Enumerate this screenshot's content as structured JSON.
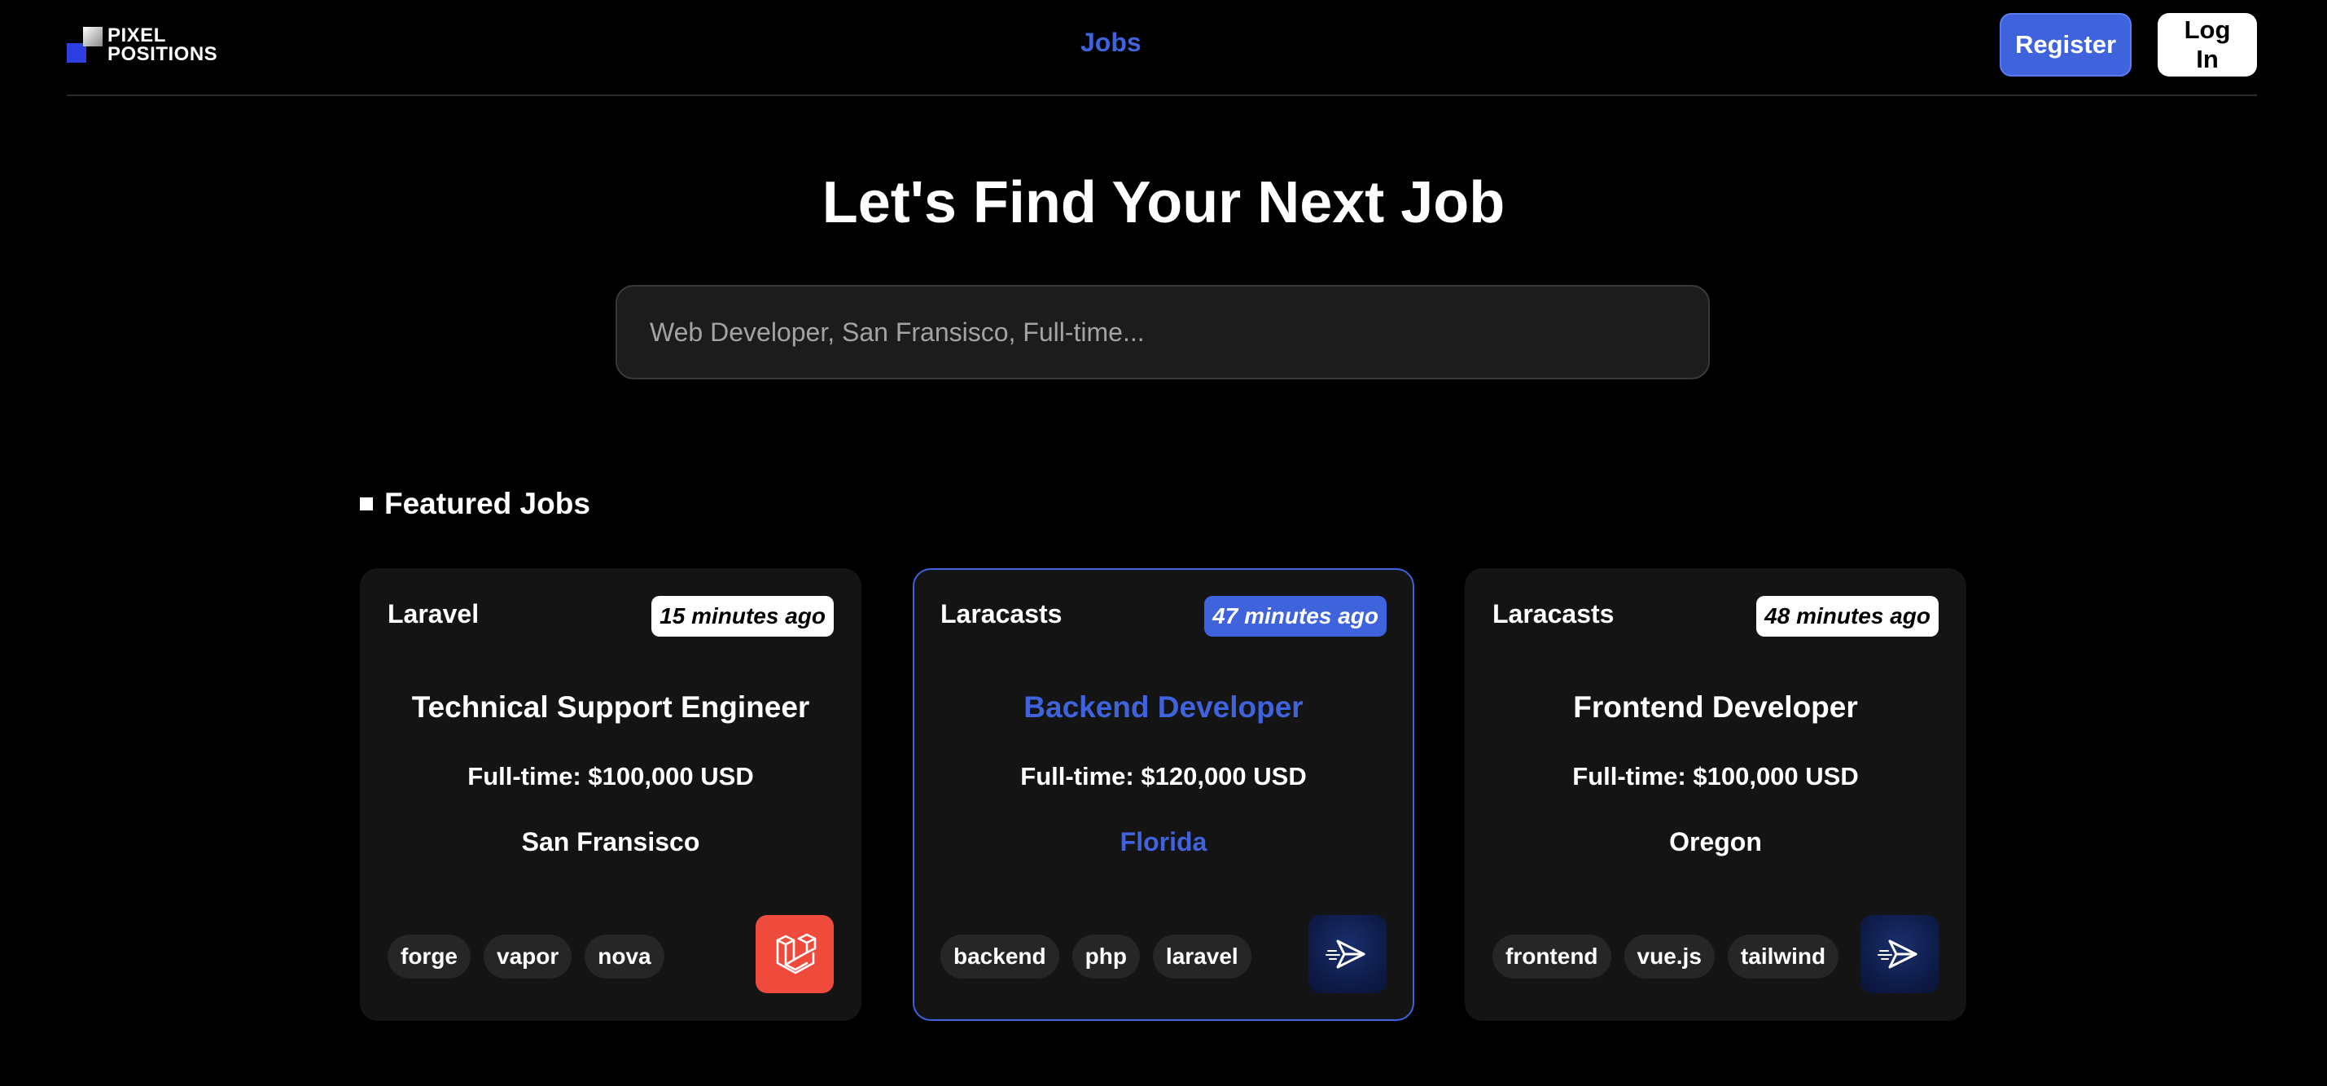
{
  "header": {
    "logo_line1": "PIXEL",
    "logo_line2": "POSITIONS",
    "nav_jobs": "Jobs",
    "register_label": "Register",
    "login_label": "Log In"
  },
  "hero": {
    "title": "Let's Find Your Next Job",
    "search_placeholder": "Web Developer, San Fransisco, Full-time..."
  },
  "featured": {
    "heading": "Featured Jobs",
    "jobs": [
      {
        "employer": "Laravel",
        "posted": "15 minutes ago",
        "title": "Technical Support Engineer",
        "salary": "Full-time: $100,000 USD",
        "location": "San Fransisco",
        "tags": [
          "forge",
          "vapor",
          "nova"
        ],
        "logo_icon": "laravel-logo-icon",
        "logo_color": "#ef4b3d"
      },
      {
        "employer": "Laracasts",
        "posted": "47 minutes ago",
        "title": "Backend Developer",
        "salary": "Full-time: $120,000 USD",
        "location": "Florida",
        "tags": [
          "backend",
          "php",
          "laravel"
        ],
        "logo_icon": "laracasts-logo-icon",
        "logo_color": "#0d1a45",
        "highlighted": true
      },
      {
        "employer": "Laracasts",
        "posted": "48 minutes ago",
        "title": "Frontend Developer",
        "salary": "Full-time: $100,000 USD",
        "location": "Oregon",
        "tags": [
          "frontend",
          "vue.js",
          "tailwind"
        ],
        "logo_icon": "laracasts-logo-icon",
        "logo_color": "#0d1a45"
      }
    ]
  },
  "colors": {
    "background": "#000000",
    "accent": "#3e63dd",
    "card_bg": "#141414",
    "tag_bg": "#262626"
  }
}
